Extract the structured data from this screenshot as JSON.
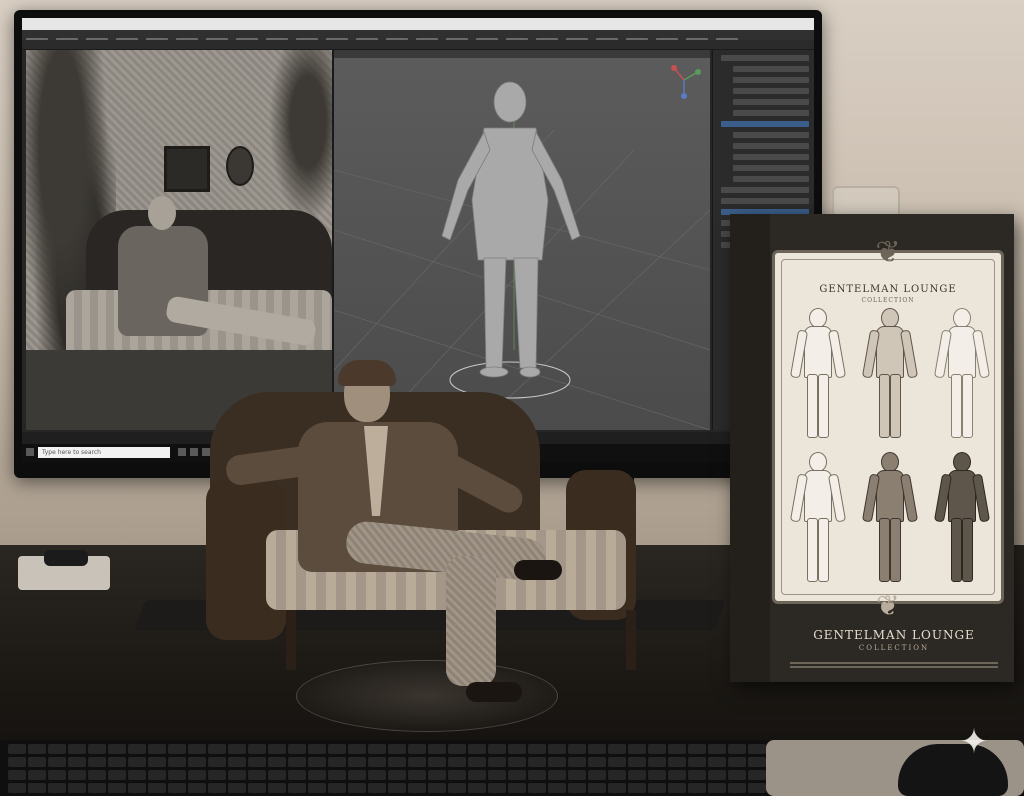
{
  "screen": {
    "taskbar_search_placeholder": "Type here to search"
  },
  "box": {
    "panel_title": "GENTELMAN LOUNGE",
    "panel_subtitle": "COLLECTION",
    "front_title": "GENTELMAN LOUNGE",
    "front_subtitle": "COLLECTION",
    "figure_variants_count_visible": 6
  },
  "colors": {
    "tone": "#b8ab98",
    "box_dark": "#2c2823",
    "panel_cream": "#ebe5da",
    "blender_grey": "#4b4b4b"
  },
  "icons": {
    "crest": "ornament-crest-icon",
    "sparkle": "sparkle-icon",
    "gizmo": "axis-gizmo-icon"
  }
}
